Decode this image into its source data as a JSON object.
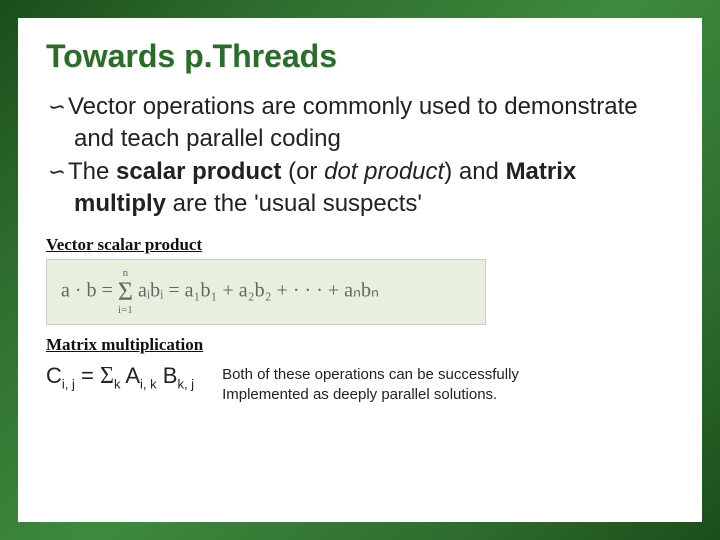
{
  "title": "Towards p.Threads",
  "bullets": {
    "b1_pre": "Vector operations are commonly used to demonstrate and teach parallel coding",
    "b2_pre": "The ",
    "b2_bold1": "scalar product",
    "b2_mid1": " (or ",
    "b2_ital": "dot product",
    "b2_mid2": ") and ",
    "b2_bold2": "Matrix multiply",
    "b2_post": " are the 'usual suspects'"
  },
  "section1_label": "Vector scalar product",
  "formula": {
    "lhs": "a · b = ",
    "sum_top": "n",
    "sum_bot": "i=1",
    "term": "aᵢbᵢ",
    "eq": " = a₁b₁ + a₂b₂ + · · · + aₙbₙ"
  },
  "section2_label": "Matrix multiplication",
  "matrix": {
    "lhs": "C",
    "lhs_sub": "i, j",
    "eq": " = ",
    "sigma": "Σ",
    "sigma_sub": "k",
    "a": " A",
    "a_sub": "i, k",
    "b": " B",
    "b_sub": "k, j"
  },
  "note_line1": "Both of these operations can be successfully",
  "note_line2": "Implemented as deeply parallel solutions."
}
